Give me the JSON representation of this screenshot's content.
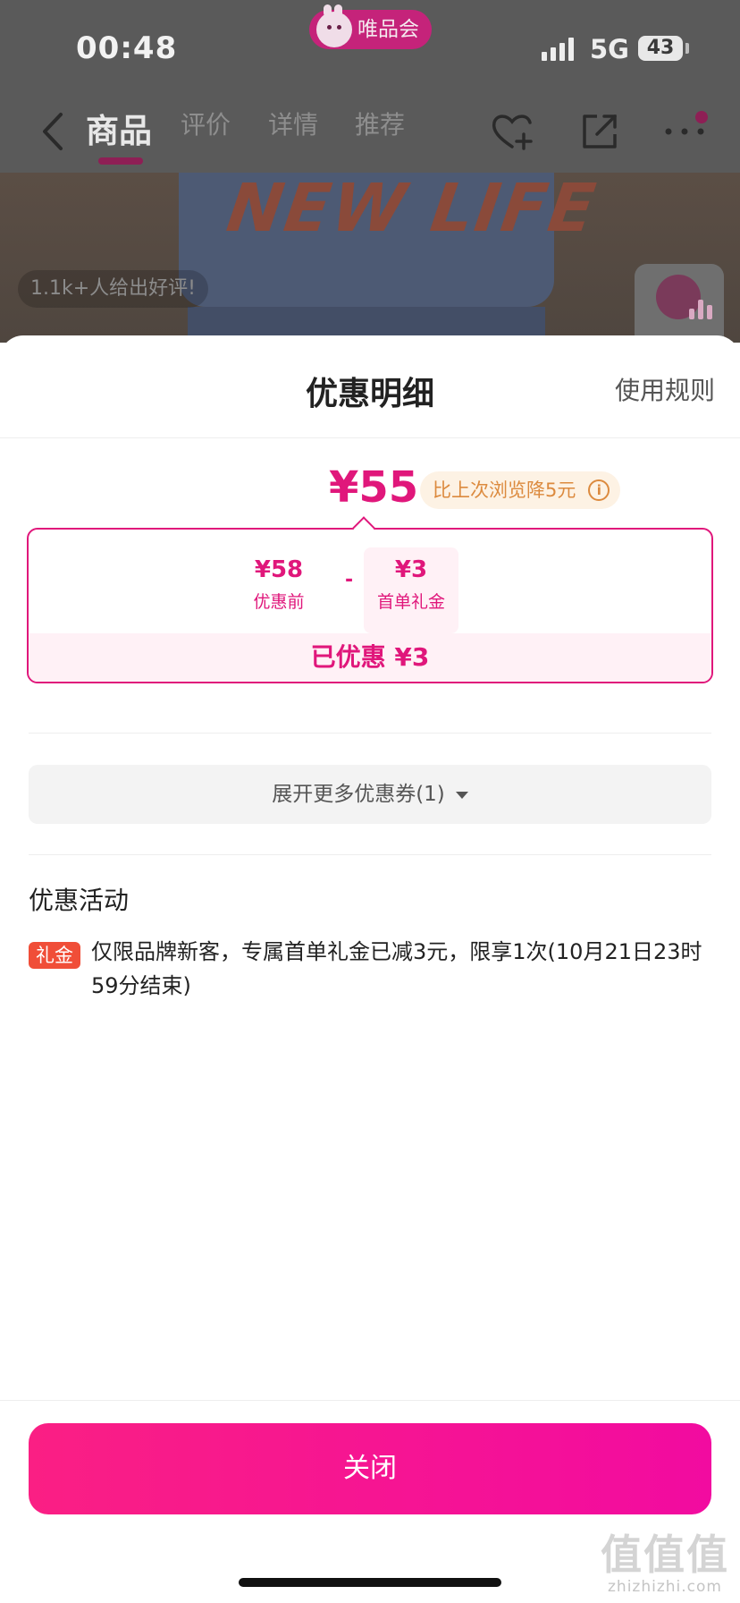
{
  "status_bar": {
    "time": "00:48",
    "app_name": "唯品会",
    "network": "5G",
    "battery": "43"
  },
  "nav": {
    "tabs": [
      {
        "label": "商品",
        "active": true
      },
      {
        "label": "评价",
        "active": false
      },
      {
        "label": "详情",
        "active": false
      },
      {
        "label": "推荐",
        "active": false
      }
    ],
    "icons": [
      "back-icon",
      "heart-plus-icon",
      "share-icon",
      "more-icon"
    ]
  },
  "background_page": {
    "review_badge": "1.1k+人给出好评!",
    "sweater_print": "NEW LIFE"
  },
  "sheet": {
    "title": "优惠明细",
    "rules_link": "使用规则",
    "final_price": "¥55",
    "price_drop_note": "比上次浏览降5元",
    "calc": {
      "original_amount": "¥58",
      "original_label": "优惠前",
      "minus": "-",
      "gift_amount": "¥3",
      "gift_label": "首单礼金",
      "saved": "已优惠 ¥3"
    },
    "expand_coupons": "展开更多优惠券(1)",
    "activity_section_title": "优惠活动",
    "activity": {
      "tag": "礼金",
      "text": "仅限品牌新客，专属首单礼金已减3元，限享1次(10月21日23时59分结束)"
    },
    "close_button": "关闭"
  },
  "watermark": {
    "main": "值值值",
    "sub": "zhizhizhi.com"
  },
  "colors": {
    "accent": "#e0177b",
    "close_gradient_start": "#fa1f84",
    "close_gradient_end": "#f20ba0",
    "gift_tag": "#f04e38",
    "drop_note": "#dc8a3e"
  }
}
